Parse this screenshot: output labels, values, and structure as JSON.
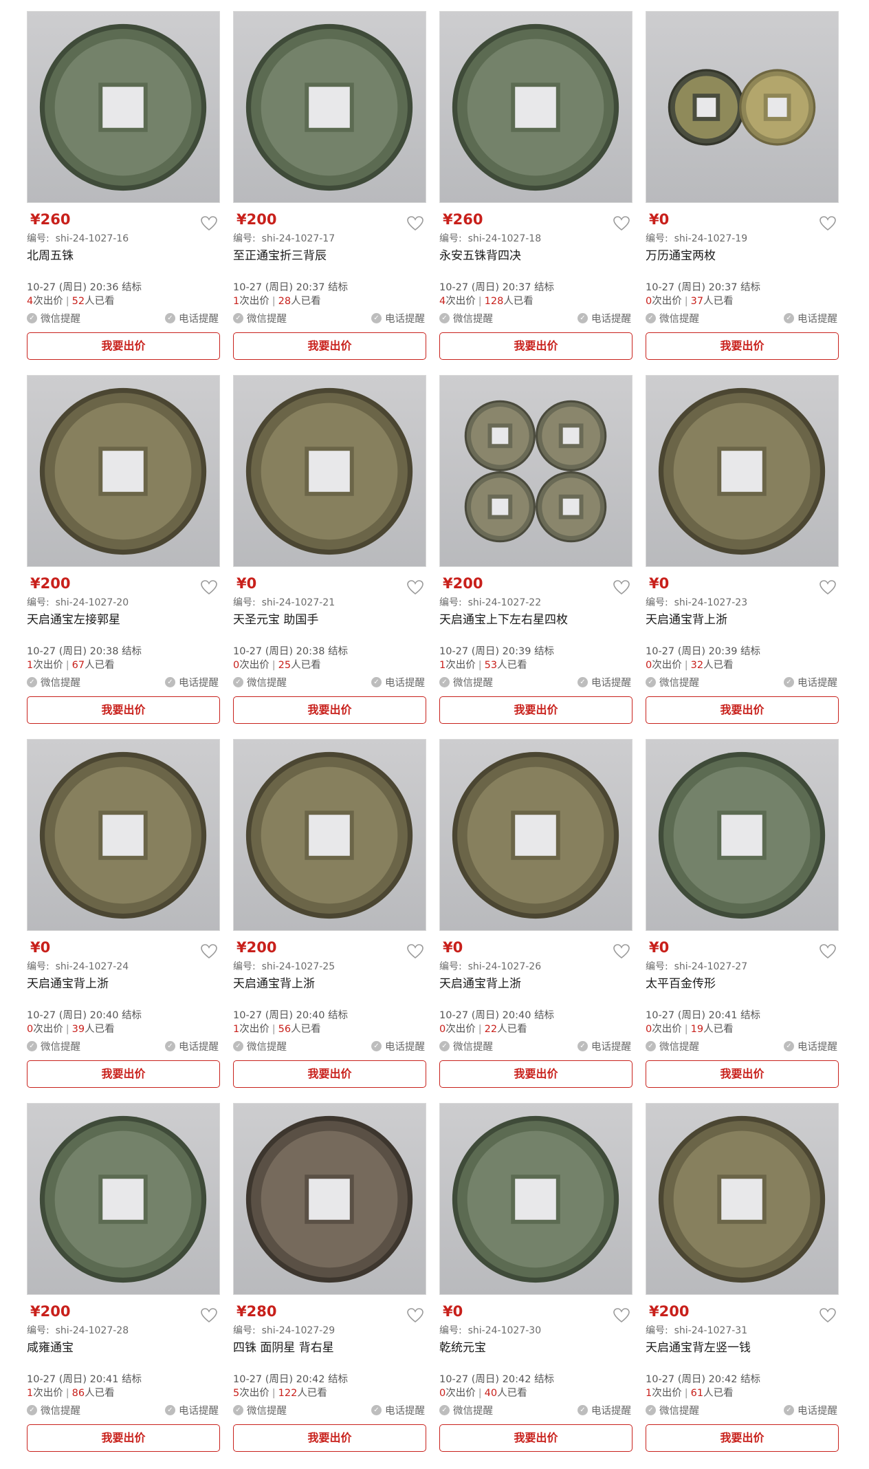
{
  "colors": {
    "accent": "#c8201b",
    "muted": "#6b6b6b",
    "photo_bg": "#c4c5c8"
  },
  "labels": {
    "code_prefix": "编号:",
    "end_suffix": "结标",
    "bids_suffix": "次出价",
    "views_suffix": "人已看",
    "wechat_remind": "微信提醒",
    "phone_remind": "电话提醒",
    "bid_button": "我要出价",
    "check_icon": "check-circle-icon",
    "favorite_icon": "heart-outline-icon"
  },
  "items": [
    {
      "price": "¥260",
      "code": "shi-24-1027-16",
      "title": "北周五铢",
      "time": "10-27 (周日) 20:36",
      "bids": "4",
      "views": "52",
      "coin": "single-green"
    },
    {
      "price": "¥200",
      "code": "shi-24-1027-17",
      "title": "至正通宝折三背辰",
      "time": "10-27 (周日) 20:37",
      "bids": "1",
      "views": "28",
      "coin": "single-green"
    },
    {
      "price": "¥260",
      "code": "shi-24-1027-18",
      "title": "永安五铢背四决",
      "time": "10-27 (周日) 20:37",
      "bids": "4",
      "views": "128",
      "coin": "single-green"
    },
    {
      "price": "¥0",
      "code": "shi-24-1027-19",
      "title": "万历通宝两枚",
      "time": "10-27 (周日) 20:37",
      "bids": "0",
      "views": "37",
      "coin": "pair"
    },
    {
      "price": "¥200",
      "code": "shi-24-1027-20",
      "title": "天启通宝左接郭星",
      "time": "10-27 (周日) 20:38",
      "bids": "1",
      "views": "67",
      "coin": "single-brown"
    },
    {
      "price": "¥0",
      "code": "shi-24-1027-21",
      "title": "天圣元宝 助国手",
      "time": "10-27 (周日) 20:38",
      "bids": "0",
      "views": "25",
      "coin": "single-brown"
    },
    {
      "price": "¥200",
      "code": "shi-24-1027-22",
      "title": "天启通宝上下左右星四枚",
      "time": "10-27 (周日) 20:39",
      "bids": "1",
      "views": "53",
      "coin": "quad"
    },
    {
      "price": "¥0",
      "code": "shi-24-1027-23",
      "title": "天启通宝背上浙",
      "time": "10-27 (周日) 20:39",
      "bids": "0",
      "views": "32",
      "coin": "single-brown"
    },
    {
      "price": "¥0",
      "code": "shi-24-1027-24",
      "title": "天启通宝背上浙",
      "time": "10-27 (周日) 20:40",
      "bids": "0",
      "views": "39",
      "coin": "single-brown"
    },
    {
      "price": "¥200",
      "code": "shi-24-1027-25",
      "title": "天启通宝背上浙",
      "time": "10-27 (周日) 20:40",
      "bids": "1",
      "views": "56",
      "coin": "single-brown"
    },
    {
      "price": "¥0",
      "code": "shi-24-1027-26",
      "title": "天启通宝背上浙",
      "time": "10-27 (周日) 20:40",
      "bids": "0",
      "views": "22",
      "coin": "single-brown"
    },
    {
      "price": "¥0",
      "code": "shi-24-1027-27",
      "title": "太平百金传形",
      "time": "10-27 (周日) 20:41",
      "bids": "0",
      "views": "19",
      "coin": "single-green"
    },
    {
      "price": "¥200",
      "code": "shi-24-1027-28",
      "title": "咸雍通宝",
      "time": "10-27 (周日) 20:41",
      "bids": "1",
      "views": "86",
      "coin": "single-green"
    },
    {
      "price": "¥280",
      "code": "shi-24-1027-29",
      "title": "四铢 面阴星 背右星",
      "time": "10-27 (周日) 20:42",
      "bids": "5",
      "views": "122",
      "coin": "single-dark"
    },
    {
      "price": "¥0",
      "code": "shi-24-1027-30",
      "title": "乾统元宝",
      "time": "10-27 (周日) 20:42",
      "bids": "0",
      "views": "40",
      "coin": "single-green"
    },
    {
      "price": "¥200",
      "code": "shi-24-1027-31",
      "title": "天启通宝背左竖一钱",
      "time": "10-27 (周日) 20:42",
      "bids": "1",
      "views": "61",
      "coin": "single-brown"
    }
  ]
}
